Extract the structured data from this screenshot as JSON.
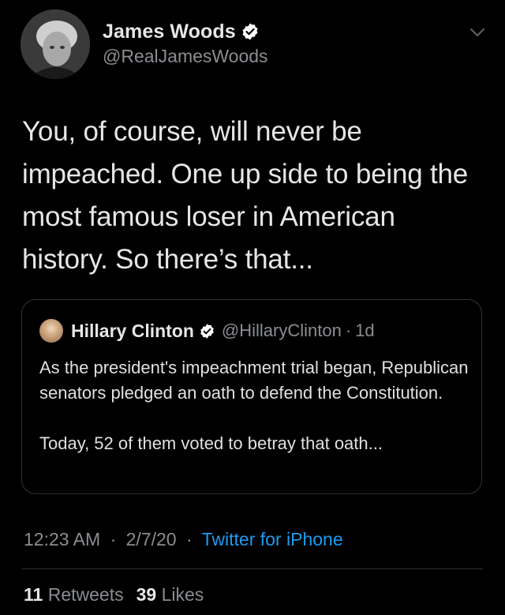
{
  "tweet": {
    "author": {
      "name": "James Woods",
      "handle": "@RealJamesWoods",
      "verified": true,
      "avatar_icon": "profile-photo"
    },
    "text": "You, of course, will never be impeached. One up side to being the most famous loser in American history. So there’s that...",
    "quoted": {
      "name": "Hillary Clinton",
      "handle": "@HillaryClinton",
      "separator": "·",
      "age": "1d",
      "verified": true,
      "paragraph1": "As the president's impeachment trial began, Republican senators pledged an oath to defend the Constitution.",
      "paragraph2": "Today, 52 of them voted to betray that oath..."
    },
    "meta": {
      "time": "12:23 AM",
      "date": "2/7/20",
      "separator": "·",
      "source": "Twitter for iPhone"
    },
    "stats": {
      "retweets_count": "11",
      "retweets_label": "Retweets",
      "likes_count": "39",
      "likes_label": "Likes"
    }
  },
  "colors": {
    "background": "#000000",
    "primary_text": "#e6e6e6",
    "secondary_text": "#8a8d91",
    "link": "#1d9bf0",
    "border": "#2f3336",
    "verified_badge": "#ffffff"
  }
}
